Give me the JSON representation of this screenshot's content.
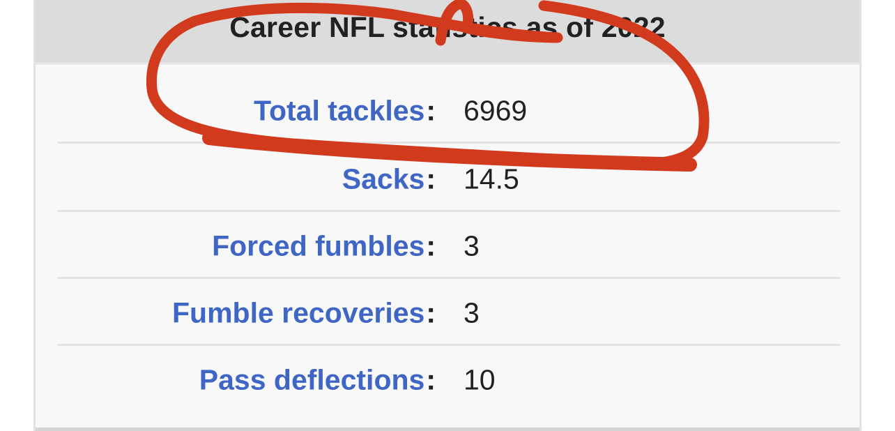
{
  "infobox": {
    "title": "Career NFL statistics as of 2022",
    "rows": [
      {
        "label": "Total tackles",
        "colon": ":",
        "value": "6969"
      },
      {
        "label": "Sacks",
        "colon": ":",
        "value": "14.5"
      },
      {
        "label": "Forced fumbles",
        "colon": ":",
        "value": "3"
      },
      {
        "label": "Fumble recoveries",
        "colon": ":",
        "value": "3"
      },
      {
        "label": "Pass deflections",
        "colon": ":",
        "value": "10"
      }
    ]
  },
  "annotation": {
    "type": "hand-drawn-circle",
    "color": "#d23a1e",
    "target": "Total tackles"
  },
  "colors": {
    "link": "#3f66c4",
    "text": "#202122",
    "header_bg": "#dcdcdc",
    "box_bg": "#f8f8f8"
  }
}
